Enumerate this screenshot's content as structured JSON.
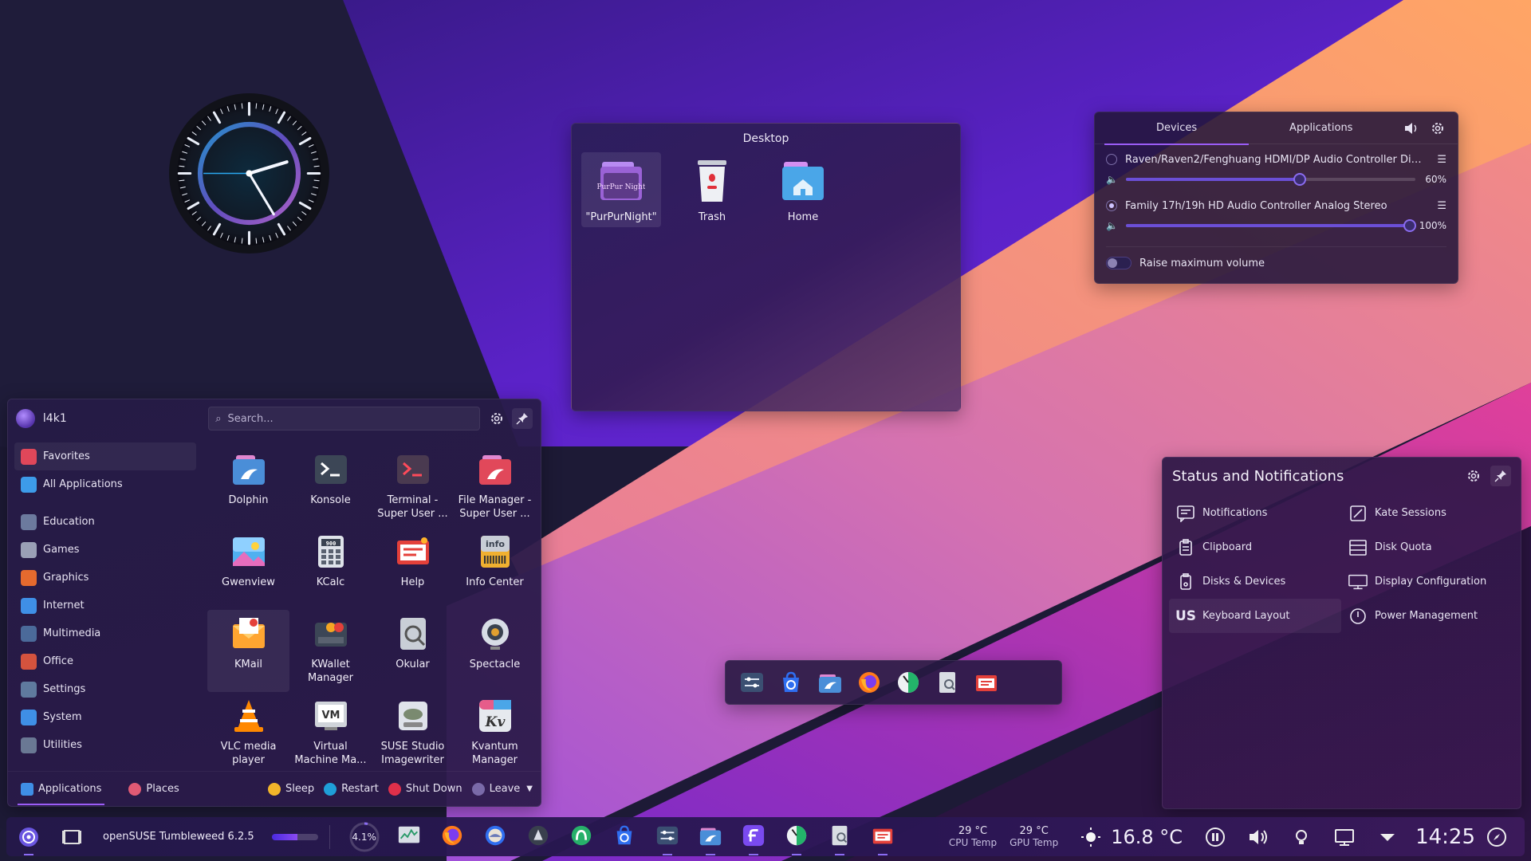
{
  "desktop": {
    "title": "Desktop",
    "icons": [
      {
        "label": "\"PurPurNight\"",
        "icon": "purpurnight-folder-icon"
      },
      {
        "label": "Trash",
        "icon": "trash-icon"
      },
      {
        "label": "Home",
        "icon": "home-folder-icon"
      }
    ],
    "folder_icon_text": "PurPur Night"
  },
  "audio": {
    "tabs": [
      "Devices",
      "Applications"
    ],
    "active_tab": "Devices",
    "devices": [
      {
        "name": "Raven/Raven2/Fenghuang HDMI/DP Audio Controller Digi...",
        "volume": 60,
        "volume_label": "60%",
        "selected": false
      },
      {
        "name": "Family 17h/19h HD Audio Controller Analog Stereo",
        "volume": 100,
        "volume_label": "100%",
        "selected": true
      }
    ],
    "raise_max_volume_label": "Raise maximum volume",
    "raise_max_volume": false
  },
  "launcher": {
    "user": "l4k1",
    "search_placeholder": "Search...",
    "categories": [
      {
        "label": "Favorites",
        "icon": "heart-icon",
        "color": "#e0475a"
      },
      {
        "label": "All Applications",
        "icon": "grid-icon",
        "color": "#3d9be9"
      },
      {
        "label": "Education",
        "icon": "graduation-cap-icon",
        "color": "#6c7a9e"
      },
      {
        "label": "Games",
        "icon": "gamepad-icon",
        "color": "#9aa0b6"
      },
      {
        "label": "Graphics",
        "icon": "graphics-icon",
        "color": "#e56a2e"
      },
      {
        "label": "Internet",
        "icon": "globe-icon",
        "color": "#3f8fe6"
      },
      {
        "label": "Multimedia",
        "icon": "film-icon",
        "color": "#4b6a9a"
      },
      {
        "label": "Office",
        "icon": "office-icon",
        "color": "#d4533e"
      },
      {
        "label": "Settings",
        "icon": "settings-sliders-icon",
        "color": "#5f7a9e"
      },
      {
        "label": "System",
        "icon": "system-gear-icon",
        "color": "#3f8fe6"
      },
      {
        "label": "Utilities",
        "icon": "toolbox-icon",
        "color": "#6a7894"
      }
    ],
    "apps": [
      {
        "label": "Dolphin",
        "icon": "dolphin-icon"
      },
      {
        "label": "Konsole",
        "icon": "konsole-icon"
      },
      {
        "label": "Terminal - Super User ...",
        "icon": "terminal-root-icon"
      },
      {
        "label": "File Manager - Super User ...",
        "icon": "file-manager-root-icon"
      },
      {
        "label": "Gwenview",
        "icon": "gwenview-icon"
      },
      {
        "label": "KCalc",
        "icon": "kcalc-icon"
      },
      {
        "label": "Help",
        "icon": "help-icon"
      },
      {
        "label": "Info Center",
        "icon": "info-center-icon"
      },
      {
        "label": "KMail",
        "icon": "kmail-icon"
      },
      {
        "label": "KWallet Manager",
        "icon": "kwallet-icon"
      },
      {
        "label": "Okular",
        "icon": "okular-icon"
      },
      {
        "label": "Spectacle",
        "icon": "spectacle-icon"
      },
      {
        "label": "VLC media player",
        "icon": "vlc-icon"
      },
      {
        "label": "Virtual Machine Ma...",
        "icon": "virt-manager-icon"
      },
      {
        "label": "SUSE Studio Imagewriter",
        "icon": "imagewriter-icon"
      },
      {
        "label": "Kvantum Manager",
        "icon": "kvantum-icon"
      }
    ],
    "info_icon_text": "info",
    "kcalc_icon_text": "900",
    "kvantum_icon_text": "Kv",
    "vm_icon_text": "VM",
    "footer": {
      "applications": "Applications",
      "places": "Places",
      "sleep": "Sleep",
      "restart": "Restart",
      "shutdown": "Shut Down",
      "leave": "Leave"
    }
  },
  "status": {
    "title": "Status and Notifications",
    "items": [
      {
        "label": "Notifications",
        "icon": "notifications-icon"
      },
      {
        "label": "Kate Sessions",
        "icon": "kate-sessions-icon"
      },
      {
        "label": "Clipboard",
        "icon": "clipboard-icon"
      },
      {
        "label": "Disk Quota",
        "icon": "disk-quota-icon"
      },
      {
        "label": "Disks & Devices",
        "icon": "disks-devices-icon"
      },
      {
        "label": "Display Configuration",
        "icon": "display-configuration-icon"
      },
      {
        "label": "Keyboard Layout",
        "icon": "keyboard-layout-icon"
      },
      {
        "label": "Power Management",
        "icon": "power-management-icon"
      }
    ],
    "keyboard_layout_code": "US"
  },
  "dock": {
    "items": [
      "system-settings-icon",
      "discover-store-icon",
      "dolphin-icon",
      "firefox-icon",
      "speedometer-icon",
      "document-viewer-icon",
      "help-center-icon"
    ]
  },
  "taskbar": {
    "os_label": "openSUSE Tumbleweed 6.2.5",
    "progress": 0.55,
    "cpu_load": "4.1%",
    "cpu_temp": {
      "value": "29 °C",
      "label": "CPU Temp"
    },
    "gpu_temp": {
      "value": "29 °C",
      "label": "GPU Temp"
    },
    "weather": "16.8 °C",
    "clock": "14:25",
    "apps": [
      "system-monitor-icon",
      "firefox-icon",
      "thunderbird-icon",
      "krita-icon",
      "mastodon-icon",
      "discover-store-icon",
      "system-settings-icon",
      "dolphin-icon",
      "fedora-icon",
      "speedometer-icon",
      "document-viewer-icon",
      "help-center-icon"
    ]
  },
  "colors": {
    "accent": "#9b5cf6",
    "bg_dark": "#1c1833",
    "stripe_orange": "#ff9a5c",
    "stripe_pink": "#e86aa8",
    "stripe_purple": "#8b3ad9"
  }
}
